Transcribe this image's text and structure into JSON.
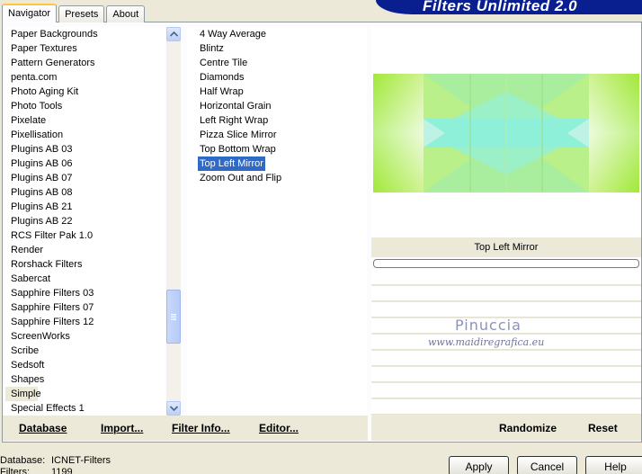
{
  "tabs": [
    {
      "label": "Navigator",
      "active": true
    },
    {
      "label": "Presets",
      "active": false
    },
    {
      "label": "About",
      "active": false
    }
  ],
  "banner": {
    "title": "Filters Unlimited 2.0"
  },
  "categories": [
    "Paper Backgrounds",
    "Paper Textures",
    "Pattern Generators",
    "penta.com",
    "Photo Aging Kit",
    "Photo Tools",
    "Pixelate",
    "Pixellisation",
    "Plugins AB 03",
    "Plugins AB 06",
    "Plugins AB 07",
    "Plugins AB 08",
    "Plugins AB 21",
    "Plugins AB 22",
    "RCS Filter Pak 1.0",
    "Render",
    "Rorshack Filters",
    "Sabercat",
    "Sapphire Filters 03",
    "Sapphire Filters 07",
    "Sapphire Filters 12",
    "ScreenWorks",
    "Scribe",
    "Sedsoft",
    "Shapes",
    "Simple",
    "Special Effects 1"
  ],
  "selected_category": "Simple",
  "filters": [
    "4 Way Average",
    "Blintz",
    "Centre Tile",
    "Diamonds",
    "Half Wrap",
    "Horizontal Grain",
    "Left Right Wrap",
    "Pizza Slice Mirror",
    "Top Bottom Wrap",
    "Top Left Mirror",
    "Zoom Out and Flip"
  ],
  "selected_filter": "Top Left Mirror",
  "preview": {
    "filter_name": "Top Left Mirror",
    "progress": 0
  },
  "watermark": {
    "line1": "Pinuccia",
    "line2": "www.maidiregrafica.eu"
  },
  "links": {
    "database": "Database",
    "import": "Import...",
    "filter_info": "Filter Info...",
    "editor": "Editor...",
    "randomize": "Randomize",
    "reset": "Reset"
  },
  "status": {
    "database_label": "Database:",
    "database_value": "ICNET-Filters",
    "filters_label": "Filters:",
    "filters_value": "1199"
  },
  "buttons": {
    "apply": "Apply",
    "cancel": "Cancel",
    "help": "Help"
  },
  "colors": {
    "selection": "#316ac5",
    "banner": "#0a1f8f",
    "preview_green": "#a6e84a",
    "preview_cyan": "#8ef0d8"
  }
}
